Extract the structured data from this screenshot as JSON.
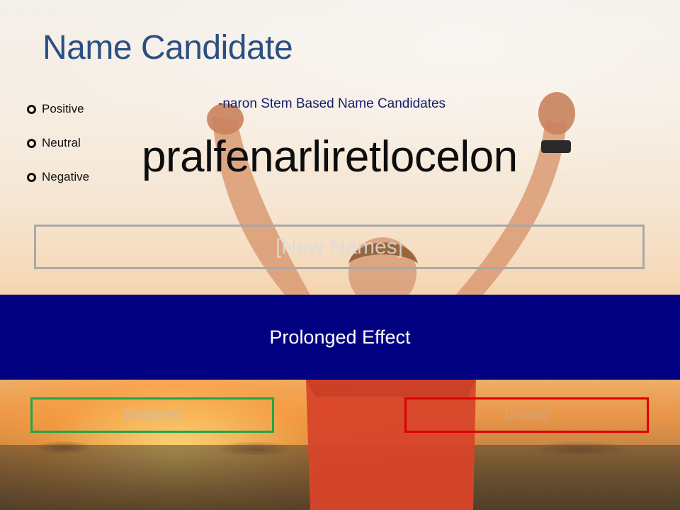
{
  "header": {
    "title": "Name Candidate"
  },
  "sentiment": {
    "options": [
      "Positive",
      "Neutral",
      "Negative"
    ]
  },
  "main": {
    "subtitle": "-naron Stem Based Name Candidates",
    "candidate_name": "pralfenarliretlocelon",
    "new_names_placeholder": "[New Names]",
    "banner_text": "Prolonged Effect"
  },
  "actions": {
    "explore_label": "[Explore]",
    "avoid_label": "[Avoid]"
  },
  "colors": {
    "title": "#2c4f82",
    "banner": "#000080",
    "explore_border": "#1ea64a",
    "avoid_border": "#e00000",
    "new_names_border": "#a8a8a8"
  }
}
